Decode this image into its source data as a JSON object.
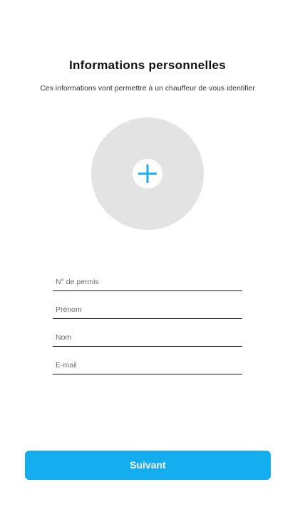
{
  "header": {
    "title": "Informations personnelles",
    "subtitle": "Ces informations vont permettre à un chauffeur de vous identifier"
  },
  "photo": {
    "icon": "plus-icon",
    "accent_color": "#14adf0",
    "placeholder_color": "#e3e3e3"
  },
  "form": {
    "license_placeholder": "N° de permis",
    "firstname_placeholder": "Prénom",
    "lastname_placeholder": "Nom",
    "email_placeholder": "E-mail"
  },
  "actions": {
    "next_label": "Suivant",
    "button_color": "#14adf0"
  }
}
